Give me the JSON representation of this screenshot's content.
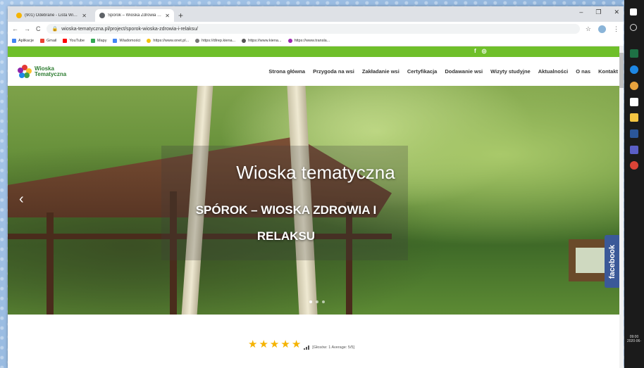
{
  "browser": {
    "tabs": [
      {
        "title": "(901) Odebrane - Lista Wiadomości",
        "active": false,
        "favicon_color": "#f6b400"
      },
      {
        "title": "Spórok – Wioska Zdrowia i Relaksu",
        "active": true,
        "favicon_color": "#5f6368"
      }
    ],
    "new_tab_label": "+",
    "window_controls": {
      "minimize": "–",
      "maximize": "❐",
      "close": "✕"
    },
    "url": "wioska-tematyczna.pl/project/sporok-wioska-zdrowia-i-relaksu/",
    "bookmarks": [
      {
        "label": "Aplikacje",
        "color": "#4285f4"
      },
      {
        "label": "Gmail",
        "color": "#ea4335"
      },
      {
        "label": "YouTube",
        "color": "#ff0000"
      },
      {
        "label": "Mapy",
        "color": "#34a853"
      },
      {
        "label": "Wiadomości",
        "color": "#4285f4"
      },
      {
        "label": "https://www.onet.pl...",
        "color": "#f4c20d"
      },
      {
        "label": "https://dlrep.kiena...",
        "color": "#777777"
      },
      {
        "label": "https://www.kiena...",
        "color": "#555555"
      },
      {
        "label": "https://www.transla...",
        "color": "#9c27b0"
      }
    ]
  },
  "site": {
    "brand_color": "#6fbf2a",
    "logo": {
      "line1": "Wioska",
      "line2": "Tematyczna"
    },
    "social": {
      "facebook": "f",
      "instagram": "◎"
    },
    "nav": [
      "Strona główna",
      "Przygoda na wsi",
      "Zakładanie wsi",
      "Certyfikacja",
      "Dodawanie wsi",
      "Wizyty studyjne",
      "Aktualności",
      "O nas",
      "Kontakt"
    ],
    "hero": {
      "subtitle": "Wioska tematyczna",
      "title": "SPÓROK – WIOSKA ZDROWIA I RELAKSU",
      "prev_arrow": "‹",
      "slides": 3,
      "active_slide": 1
    },
    "facebook_tab": "facebook",
    "rating": {
      "stars": 5,
      "text": "[Głosów: 1   Average: 5/5]"
    }
  },
  "taskbar": {
    "time": "09:00",
    "date": "2020-06-"
  }
}
